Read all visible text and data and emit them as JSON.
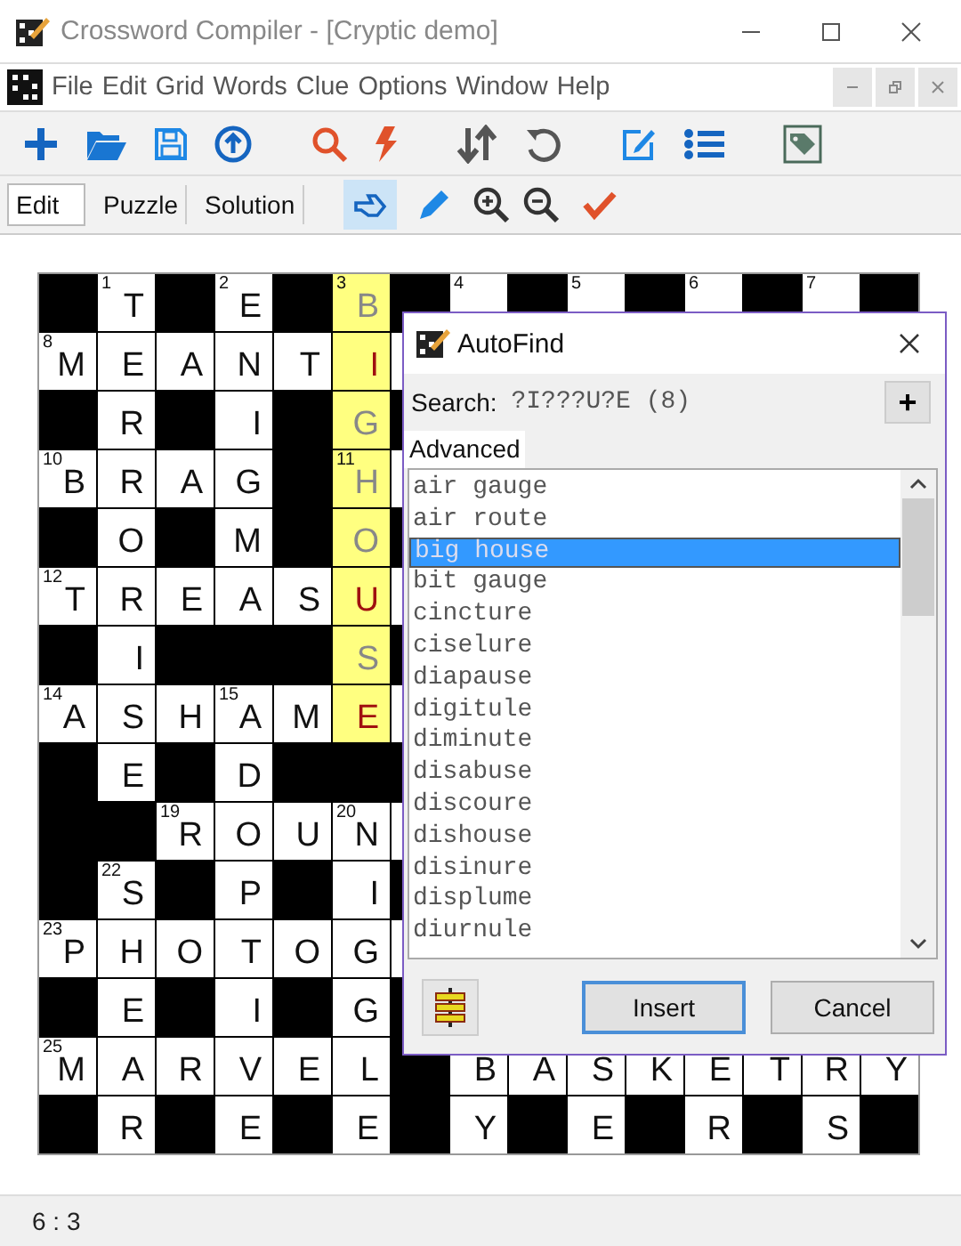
{
  "window": {
    "title": "Crossword Compiler - [Cryptic demo]"
  },
  "menu": [
    "File",
    "Edit",
    "Grid",
    "Words",
    "Clue",
    "Options",
    "Window",
    "Help"
  ],
  "mode_tabs": [
    {
      "label": "Edit",
      "selected": true
    },
    {
      "label": "Puzzle",
      "selected": false
    },
    {
      "label": "Solution",
      "selected": false
    }
  ],
  "tools": [
    {
      "selected": true
    },
    {
      "selected": false
    }
  ],
  "grid": [
    [
      {
        "kind": "block"
      },
      {
        "kind": "letter",
        "number": "1",
        "letter": "T",
        "highlighted": false
      },
      {
        "kind": "block"
      },
      {
        "kind": "letter",
        "number": "2",
        "letter": "E",
        "highlighted": false
      },
      {
        "kind": "block"
      },
      {
        "kind": "letter",
        "number": "3",
        "letter": "B",
        "highlighted": true,
        "suggested": true
      },
      {
        "kind": "block"
      },
      {
        "kind": "letter",
        "number": "4",
        "highlighted": false
      },
      {
        "kind": "block"
      },
      {
        "kind": "letter",
        "number": "5",
        "highlighted": false
      },
      {
        "kind": "block"
      },
      {
        "kind": "letter",
        "number": "6",
        "highlighted": false
      },
      {
        "kind": "block"
      },
      {
        "kind": "letter",
        "number": "7",
        "highlighted": false
      },
      {
        "kind": "block"
      }
    ],
    [
      {
        "kind": "letter",
        "number": "8",
        "letter": "M",
        "highlighted": false
      },
      {
        "kind": "letter",
        "letter": "E",
        "highlighted": false
      },
      {
        "kind": "letter",
        "letter": "A",
        "highlighted": false
      },
      {
        "kind": "letter",
        "letter": "N",
        "highlighted": false
      },
      {
        "kind": "letter",
        "letter": "T",
        "highlighted": false
      },
      {
        "kind": "letter",
        "letter": "I",
        "highlighted": true,
        "suggested": false
      },
      {
        "kind": "letter",
        "highlighted": false
      }
    ],
    [
      {
        "kind": "block"
      },
      {
        "kind": "letter",
        "letter": "R",
        "highlighted": false
      },
      {
        "kind": "block"
      },
      {
        "kind": "letter",
        "letter": "I",
        "highlighted": false
      },
      {
        "kind": "block"
      },
      {
        "kind": "letter",
        "letter": "G",
        "highlighted": true,
        "suggested": true
      },
      {
        "kind": "block"
      }
    ],
    [
      {
        "kind": "letter",
        "number": "10",
        "letter": "B",
        "highlighted": false
      },
      {
        "kind": "letter",
        "letter": "R",
        "highlighted": false
      },
      {
        "kind": "letter",
        "letter": "A",
        "highlighted": false
      },
      {
        "kind": "letter",
        "letter": "G",
        "highlighted": false
      },
      {
        "kind": "block"
      },
      {
        "kind": "letter",
        "number": "11",
        "letter": "H",
        "highlighted": true,
        "suggested": true
      },
      {
        "kind": "letter",
        "highlighted": false
      }
    ],
    [
      {
        "kind": "block"
      },
      {
        "kind": "letter",
        "letter": "O",
        "highlighted": false
      },
      {
        "kind": "block"
      },
      {
        "kind": "letter",
        "letter": "M",
        "highlighted": false
      },
      {
        "kind": "block"
      },
      {
        "kind": "letter",
        "letter": "O",
        "highlighted": true,
        "suggested": true
      },
      {
        "kind": "block"
      }
    ],
    [
      {
        "kind": "letter",
        "number": "12",
        "letter": "T",
        "highlighted": false
      },
      {
        "kind": "letter",
        "letter": "R",
        "highlighted": false
      },
      {
        "kind": "letter",
        "letter": "E",
        "highlighted": false
      },
      {
        "kind": "letter",
        "letter": "A",
        "highlighted": false
      },
      {
        "kind": "letter",
        "letter": "S",
        "highlighted": false
      },
      {
        "kind": "letter",
        "letter": "U",
        "highlighted": true,
        "suggested": false
      },
      {
        "kind": "letter",
        "highlighted": false
      }
    ],
    [
      {
        "kind": "block"
      },
      {
        "kind": "letter",
        "letter": "I",
        "highlighted": false
      },
      {
        "kind": "block"
      },
      {
        "kind": "block"
      },
      {
        "kind": "block"
      },
      {
        "kind": "letter",
        "letter": "S",
        "highlighted": true,
        "suggested": true
      },
      {
        "kind": "block"
      }
    ],
    [
      {
        "kind": "letter",
        "number": "14",
        "letter": "A",
        "highlighted": false
      },
      {
        "kind": "letter",
        "letter": "S",
        "highlighted": false
      },
      {
        "kind": "letter",
        "letter": "H",
        "highlighted": false
      },
      {
        "kind": "letter",
        "number": "15",
        "letter": "A",
        "highlighted": false
      },
      {
        "kind": "letter",
        "letter": "M",
        "highlighted": false
      },
      {
        "kind": "letter",
        "letter": "E",
        "highlighted": true,
        "suggested": false
      },
      {
        "kind": "letter",
        "highlighted": false
      }
    ],
    [
      {
        "kind": "block"
      },
      {
        "kind": "letter",
        "letter": "E",
        "highlighted": false
      },
      {
        "kind": "block"
      },
      {
        "kind": "letter",
        "letter": "D",
        "highlighted": false
      },
      {
        "kind": "block"
      },
      {
        "kind": "block"
      },
      {
        "kind": "block"
      }
    ],
    [
      {
        "kind": "block"
      },
      {
        "kind": "block"
      },
      {
        "kind": "letter",
        "number": "19",
        "letter": "R",
        "highlighted": false
      },
      {
        "kind": "letter",
        "letter": "O",
        "highlighted": false
      },
      {
        "kind": "letter",
        "letter": "U",
        "highlighted": false
      },
      {
        "kind": "letter",
        "number": "20",
        "letter": "N",
        "highlighted": false
      },
      {
        "kind": "letter",
        "highlighted": false
      }
    ],
    [
      {
        "kind": "block"
      },
      {
        "kind": "letter",
        "number": "22",
        "letter": "S",
        "highlighted": false
      },
      {
        "kind": "block"
      },
      {
        "kind": "letter",
        "letter": "P",
        "highlighted": false
      },
      {
        "kind": "block"
      },
      {
        "kind": "letter",
        "letter": "I",
        "highlighted": false
      },
      {
        "kind": "block"
      }
    ],
    [
      {
        "kind": "letter",
        "number": "23",
        "letter": "P",
        "highlighted": false
      },
      {
        "kind": "letter",
        "letter": "H",
        "highlighted": false
      },
      {
        "kind": "letter",
        "letter": "O",
        "highlighted": false
      },
      {
        "kind": "letter",
        "letter": "T",
        "highlighted": false
      },
      {
        "kind": "letter",
        "letter": "O",
        "highlighted": false
      },
      {
        "kind": "letter",
        "letter": "G",
        "highlighted": false
      },
      {
        "kind": "letter",
        "highlighted": false
      }
    ],
    [
      {
        "kind": "block"
      },
      {
        "kind": "letter",
        "letter": "E",
        "highlighted": false
      },
      {
        "kind": "block"
      },
      {
        "kind": "letter",
        "letter": "I",
        "highlighted": false
      },
      {
        "kind": "block"
      },
      {
        "kind": "letter",
        "letter": "G",
        "highlighted": false
      },
      {
        "kind": "block"
      }
    ],
    [
      {
        "kind": "letter",
        "number": "25",
        "letter": "M",
        "highlighted": false
      },
      {
        "kind": "letter",
        "letter": "A",
        "highlighted": false
      },
      {
        "kind": "letter",
        "letter": "R",
        "highlighted": false
      },
      {
        "kind": "letter",
        "letter": "V",
        "highlighted": false
      },
      {
        "kind": "letter",
        "letter": "E",
        "highlighted": false
      },
      {
        "kind": "letter",
        "letter": "L",
        "highlighted": false
      },
      {
        "kind": "block"
      },
      {
        "kind": "letter",
        "letter": "B",
        "highlighted": false
      },
      {
        "kind": "letter",
        "letter": "A",
        "highlighted": false
      },
      {
        "kind": "letter",
        "letter": "S",
        "highlighted": false
      },
      {
        "kind": "letter",
        "letter": "K",
        "highlighted": false
      },
      {
        "kind": "letter",
        "letter": "E",
        "highlighted": false
      },
      {
        "kind": "letter",
        "letter": "T",
        "highlighted": false
      },
      {
        "kind": "letter",
        "letter": "R",
        "highlighted": false
      },
      {
        "kind": "letter",
        "letter": "Y",
        "highlighted": false
      }
    ],
    [
      {
        "kind": "block"
      },
      {
        "kind": "letter",
        "letter": "R",
        "highlighted": false
      },
      {
        "kind": "block"
      },
      {
        "kind": "letter",
        "letter": "E",
        "highlighted": false
      },
      {
        "kind": "block"
      },
      {
        "kind": "letter",
        "letter": "E",
        "highlighted": false
      },
      {
        "kind": "block"
      },
      {
        "kind": "letter",
        "letter": "Y",
        "highlighted": false
      },
      {
        "kind": "block"
      },
      {
        "kind": "letter",
        "letter": "E",
        "highlighted": false
      },
      {
        "kind": "block"
      },
      {
        "kind": "letter",
        "letter": "R",
        "highlighted": false
      },
      {
        "kind": "block"
      },
      {
        "kind": "letter",
        "letter": "S",
        "highlighted": false
      },
      {
        "kind": "block"
      }
    ]
  ],
  "autofind": {
    "title": "AutoFind",
    "search_label": "Search:",
    "search_value": "?I???U?E (8)",
    "add_button": "+",
    "advanced_label": "Advanced",
    "results": [
      {
        "text": "air gauge",
        "selected": false
      },
      {
        "text": "air route",
        "selected": false
      },
      {
        "text": "big house",
        "selected": true
      },
      {
        "text": "bit gauge",
        "selected": false
      },
      {
        "text": "cincture",
        "selected": false
      },
      {
        "text": "ciselure",
        "selected": false
      },
      {
        "text": "diapause",
        "selected": false
      },
      {
        "text": "digitule",
        "selected": false
      },
      {
        "text": "diminute",
        "selected": false
      },
      {
        "text": "disabuse",
        "selected": false
      },
      {
        "text": "discoure",
        "selected": false
      },
      {
        "text": "dishouse",
        "selected": false
      },
      {
        "text": "disinure",
        "selected": false
      },
      {
        "text": "displume",
        "selected": false
      },
      {
        "text": "diurnule",
        "selected": false
      }
    ],
    "buttons": [
      "Insert",
      "Cancel"
    ]
  },
  "status_bar": "6 : 3"
}
